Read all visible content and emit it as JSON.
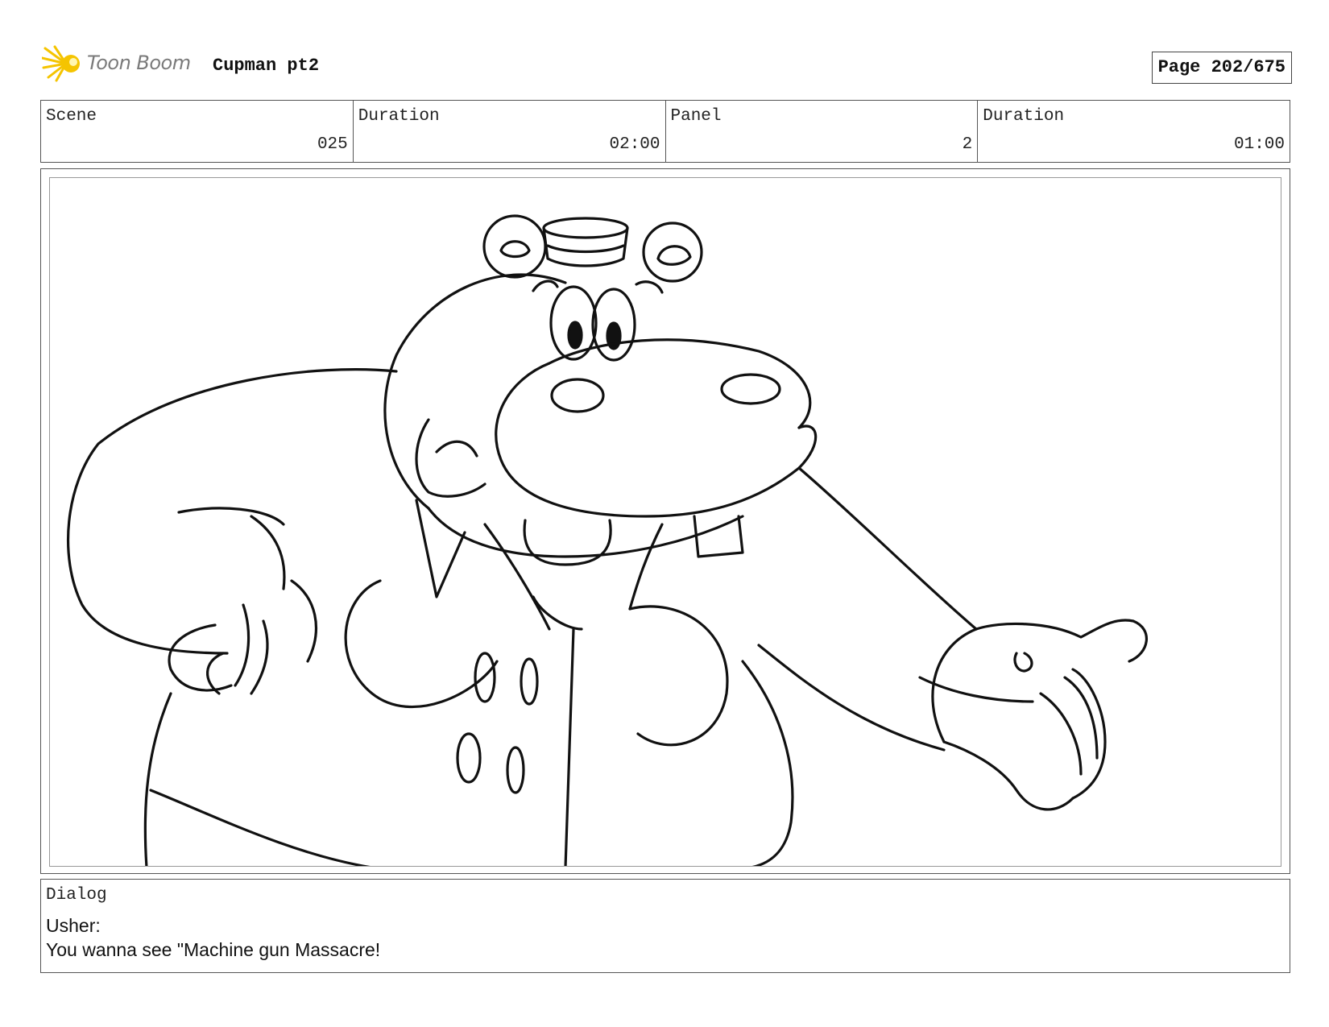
{
  "header": {
    "logo_text": "Toon Boom",
    "project_title": "Cupman pt2",
    "page_label": "Page 202/675"
  },
  "info": {
    "scene_label": "Scene",
    "scene_value": "025",
    "scene_duration_label": "Duration",
    "scene_duration_value": "02:00",
    "panel_label": "Panel",
    "panel_value": "2",
    "panel_duration_label": "Duration",
    "panel_duration_value": "01:00"
  },
  "panel_image": {
    "icon": "hippo-usher-sketch"
  },
  "dialog": {
    "label": "Dialog",
    "speaker": "Usher:",
    "line": "You wanna see \"Machine gun Massacre!"
  },
  "colors": {
    "logo_accent": "#f5c400",
    "logo_text": "#7a7a7a",
    "border": "#555555"
  }
}
